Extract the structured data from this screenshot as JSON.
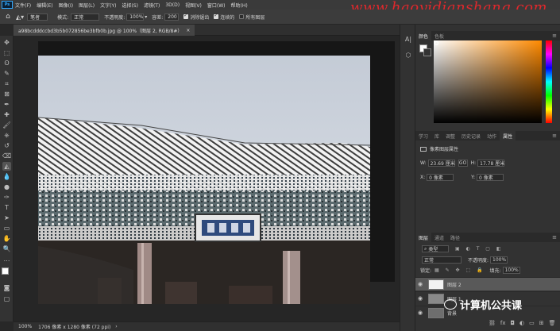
{
  "app": {
    "logo": "Ps"
  },
  "menu": [
    "文件(F)",
    "编辑(E)",
    "图像(I)",
    "图层(L)",
    "文字(Y)",
    "选择(S)",
    "滤镜(T)",
    "3D(D)",
    "视图(V)",
    "窗口(W)",
    "帮助(H)"
  ],
  "watermark": "www.haoyidianshang.com",
  "options": {
    "brush_size": "笔者",
    "mode_label": "模式:",
    "mode_value": "正常",
    "opacity_label": "不透明度:",
    "opacity_value": "100%",
    "tolerance_label": "容差:",
    "tolerance_value": "200",
    "antialias_label": "消除锯齿",
    "contiguous_label": "连续的",
    "all_layers_label": "所有图层"
  },
  "document": {
    "tab_title": "a98bcdddccbd3b5b072856be3bfb0b.jpg @ 100%（图层 2, RGB/8#）",
    "status_zoom": "100%",
    "status_info": "1706 像素 x 1280 像素 (72 ppi)"
  },
  "color_panel": {
    "tabs": [
      "颜色",
      "色板"
    ]
  },
  "properties_panel": {
    "tabs": [
      "学习",
      "库",
      "调整",
      "历史记录",
      "动作",
      "属性"
    ],
    "header": "像素图层属性",
    "w_label": "W:",
    "w_value": "23.69 厘米",
    "link_label": "GO",
    "h_label": "H:",
    "h_value": "17.78 厘米",
    "x_label": "X:",
    "x_value": "0 像素",
    "y_label": "Y:",
    "y_value": "0 像素"
  },
  "layers_panel": {
    "tabs": [
      "图层",
      "通道",
      "路径"
    ],
    "filter_label": "类型",
    "blend_mode": "正常",
    "opacity_label": "不透明度:",
    "opacity_value": "100%",
    "lock_label": "锁定:",
    "fill_label": "填充:",
    "fill_value": "100%",
    "layers": [
      {
        "name": "图层 2",
        "selected": true
      },
      {
        "name": "图层 1",
        "selected": false
      },
      {
        "name": "背景",
        "selected": false
      }
    ]
  },
  "wechat_overlay": "计算机公共课",
  "icons": {
    "menu_more": "≡",
    "eye": "eye-icon"
  }
}
